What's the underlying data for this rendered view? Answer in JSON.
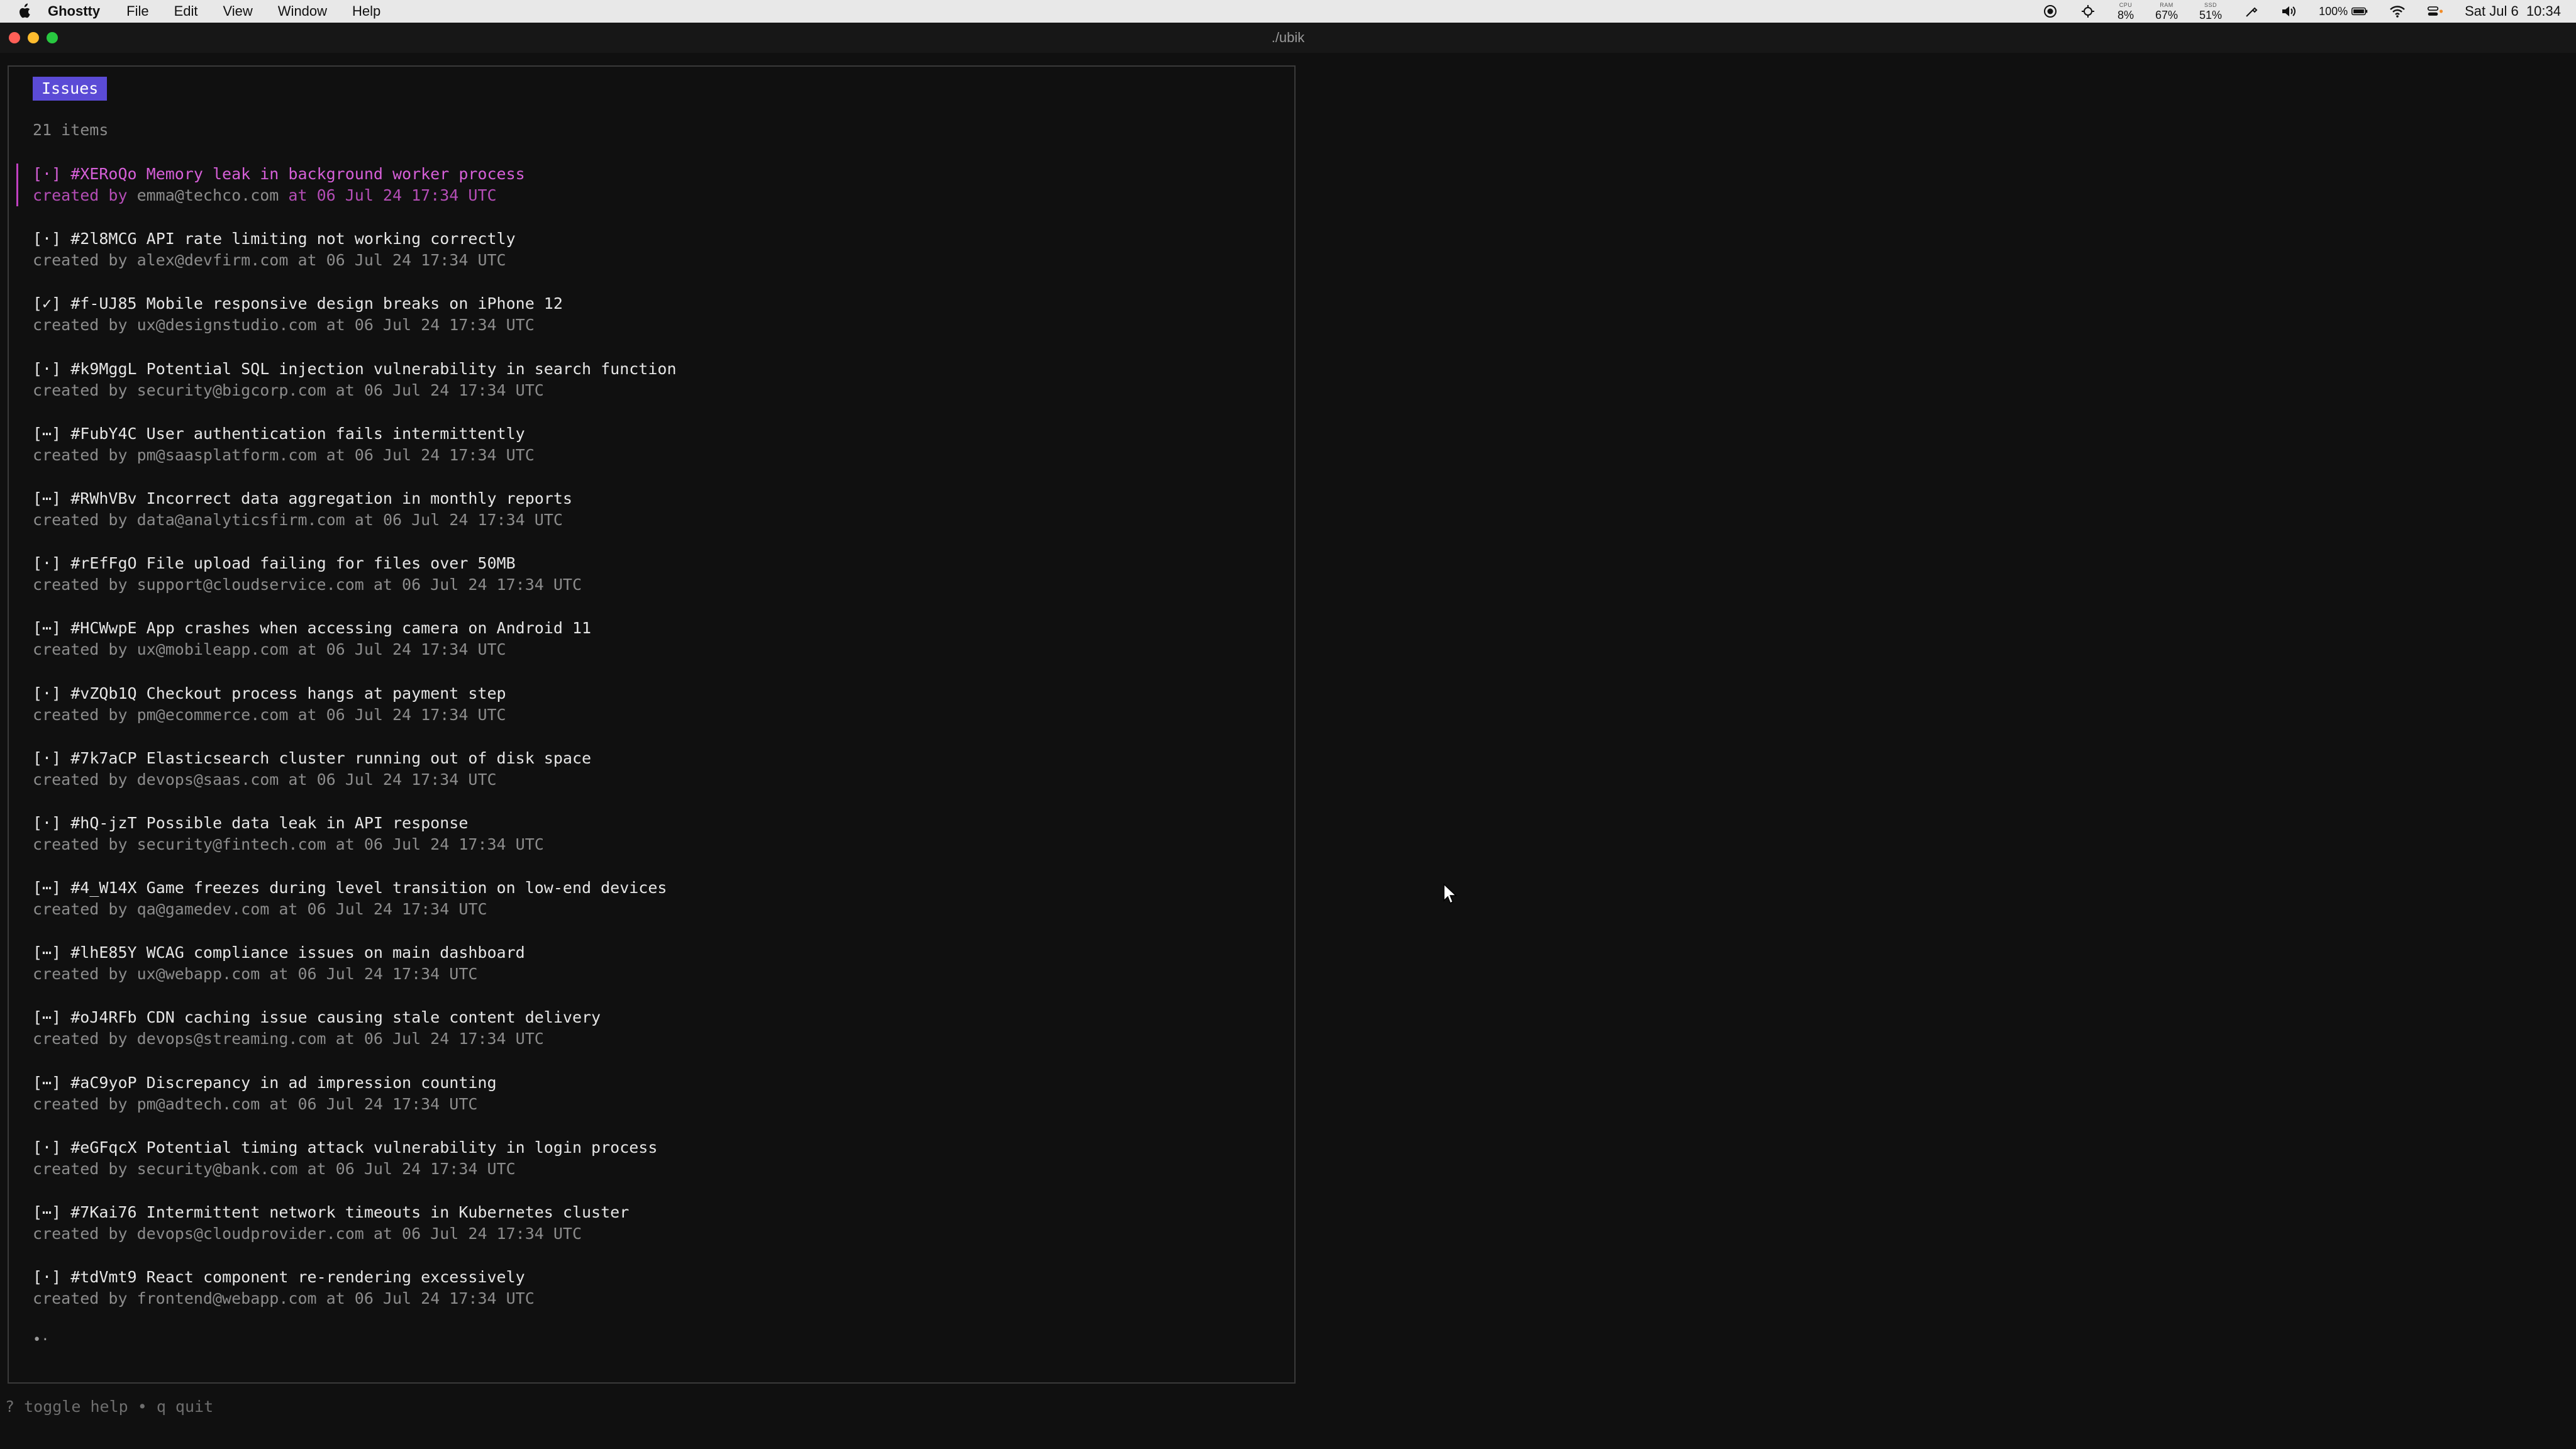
{
  "menubar": {
    "app_name": "Ghostty",
    "menus": [
      "File",
      "Edit",
      "View",
      "Window",
      "Help"
    ],
    "stats": [
      {
        "label": "CPU",
        "value": "8%"
      },
      {
        "label": "RAM",
        "value": "67%"
      },
      {
        "label": "SSD",
        "value": "51%"
      }
    ],
    "battery": "100%",
    "datetime": "Sat Jul 6  10:34"
  },
  "window": {
    "title": "./ubik"
  },
  "panel": {
    "tab_label": "Issues",
    "count_text": "21 items",
    "pager": "•·",
    "items": [
      {
        "status": "[·]",
        "id": "#XERoQo",
        "title": "Memory leak in background worker process",
        "email": "emma@techco.com",
        "created": "06 Jul 24 17:34 UTC",
        "selected": true
      },
      {
        "status": "[·]",
        "id": "#2l8MCG",
        "title": "API rate limiting not working correctly",
        "email": "alex@devfirm.com",
        "created": "06 Jul 24 17:34 UTC"
      },
      {
        "status": "[✓]",
        "id": "#f-UJ85",
        "title": "Mobile responsive design breaks on iPhone 12",
        "email": "ux@designstudio.com",
        "created": "06 Jul 24 17:34 UTC"
      },
      {
        "status": "[·]",
        "id": "#k9MggL",
        "title": "Potential SQL injection vulnerability in search function",
        "email": "security@bigcorp.com",
        "created": "06 Jul 24 17:34 UTC"
      },
      {
        "status": "[⋯]",
        "id": "#FubY4C",
        "title": "User authentication fails intermittently",
        "email": "pm@saasplatform.com",
        "created": "06 Jul 24 17:34 UTC"
      },
      {
        "status": "[⋯]",
        "id": "#RWhVBv",
        "title": "Incorrect data aggregation in monthly reports",
        "email": "data@analyticsfirm.com",
        "created": "06 Jul 24 17:34 UTC"
      },
      {
        "status": "[·]",
        "id": "#rEfFgO",
        "title": "File upload failing for files over 50MB",
        "email": "support@cloudservice.com",
        "created": "06 Jul 24 17:34 UTC"
      },
      {
        "status": "[⋯]",
        "id": "#HCWwpE",
        "title": "App crashes when accessing camera on Android 11",
        "email": "ux@mobileapp.com",
        "created": "06 Jul 24 17:34 UTC"
      },
      {
        "status": "[·]",
        "id": "#vZQb1Q",
        "title": "Checkout process hangs at payment step",
        "email": "pm@ecommerce.com",
        "created": "06 Jul 24 17:34 UTC"
      },
      {
        "status": "[·]",
        "id": "#7k7aCP",
        "title": "Elasticsearch cluster running out of disk space",
        "email": "devops@saas.com",
        "created": "06 Jul 24 17:34 UTC"
      },
      {
        "status": "[·]",
        "id": "#hQ-jzT",
        "title": "Possible data leak in API response",
        "email": "security@fintech.com",
        "created": "06 Jul 24 17:34 UTC"
      },
      {
        "status": "[⋯]",
        "id": "#4_W14X",
        "title": "Game freezes during level transition on low-end devices",
        "email": "qa@gamedev.com",
        "created": "06 Jul 24 17:34 UTC"
      },
      {
        "status": "[⋯]",
        "id": "#lhE85Y",
        "title": "WCAG compliance issues on main dashboard",
        "email": "ux@webapp.com",
        "created": "06 Jul 24 17:34 UTC"
      },
      {
        "status": "[⋯]",
        "id": "#oJ4RFb",
        "title": "CDN caching issue causing stale content delivery",
        "email": "devops@streaming.com",
        "created": "06 Jul 24 17:34 UTC"
      },
      {
        "status": "[⋯]",
        "id": "#aC9yoP",
        "title": "Discrepancy in ad impression counting",
        "email": "pm@adtech.com",
        "created": "06 Jul 24 17:34 UTC"
      },
      {
        "status": "[·]",
        "id": "#eGFqcX",
        "title": "Potential timing attack vulnerability in login process",
        "email": "security@bank.com",
        "created": "06 Jul 24 17:34 UTC"
      },
      {
        "status": "[⋯]",
        "id": "#7Kai76",
        "title": "Intermittent network timeouts in Kubernetes cluster",
        "email": "devops@cloudprovider.com",
        "created": "06 Jul 24 17:34 UTC"
      },
      {
        "status": "[·]",
        "id": "#tdVmt9",
        "title": "React component re-rendering excessively",
        "email": "frontend@webapp.com",
        "created": "06 Jul 24 17:34 UTC"
      }
    ]
  },
  "helpbar": {
    "text": "? toggle help • q quit"
  }
}
